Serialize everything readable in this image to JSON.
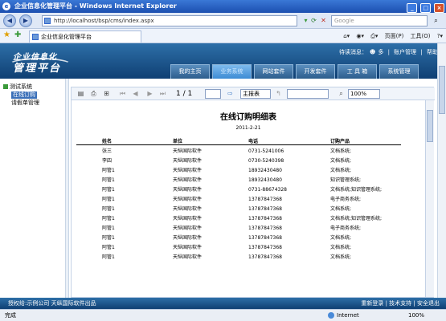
{
  "window": {
    "title": "企业信息化管理平台 - Windows Internet Explorer",
    "minimize": "_",
    "maximize": "□",
    "close": "×"
  },
  "address": {
    "url": "http://localhost/bsp/cms/index.aspx",
    "search_placeholder": "Google"
  },
  "tab": {
    "title": "企业信息化管理平台"
  },
  "toolbar_right": {
    "page": "页面(P)",
    "tools": "工具(O)"
  },
  "site": {
    "logo_line1": "企业信息化",
    "logo_line2": "管理平台",
    "message_prefix": "待读消息：",
    "message_user": "多",
    "account": "账户管理",
    "help": "帮助",
    "separator": "|"
  },
  "nav_tabs": [
    {
      "label": "我的主页"
    },
    {
      "label": "业务系统"
    },
    {
      "label": "网站套件"
    },
    {
      "label": "开发套件"
    },
    {
      "label": "工 具 箱"
    },
    {
      "label": "系统管理"
    }
  ],
  "sidebar": {
    "root": "测试系统",
    "items": [
      {
        "label": "在线订购"
      },
      {
        "label": "请假单管理"
      }
    ]
  },
  "report_toolbar": {
    "page_indicator": "1 / 1",
    "format": "主报表",
    "zoom": "100%"
  },
  "report": {
    "title": "在线订购明细表",
    "date": "2011-2-21",
    "columns": [
      "姓名",
      "单位",
      "电话",
      "订购产品"
    ],
    "rows": [
      [
        "张三",
        "天纵国际软件",
        "0731-5241006",
        "文档系统;"
      ],
      [
        "李四",
        "天纵国际软件",
        "0730-5240398",
        "文档系统;"
      ],
      [
        "阿管1",
        "天纵国际软件",
        "18932430480",
        "文档系统;"
      ],
      [
        "阿管1",
        "天纵国际软件",
        "18932430480",
        "知识管理系统;"
      ],
      [
        "阿管1",
        "天纵国际软件",
        "0731-88674328",
        "文档系统;知识管理系统;"
      ],
      [
        "阿管1",
        "天纵国际软件",
        "13787847368",
        "电子商务系统;"
      ],
      [
        "阿管1",
        "天纵国际软件",
        "13787847368",
        "文档系统;"
      ],
      [
        "阿管1",
        "天纵国际软件",
        "13787847368",
        "文档系统;知识管理系统;"
      ],
      [
        "阿管1",
        "天纵国际软件",
        "13787847368",
        "电子商务系统;"
      ],
      [
        "阿管1",
        "天纵国际软件",
        "13787847368",
        "文档系统;"
      ],
      [
        "阿管1",
        "天纵国际软件",
        "13787847368",
        "文档系统;"
      ],
      [
        "阿管1",
        "天纵国际软件",
        "13787847368",
        "文档系统;"
      ]
    ]
  },
  "footer": {
    "left": "授权给:示例公司 天纵国际软件出品",
    "right": "重新登录 | 技术支持 | 安全退出"
  },
  "statusbar": {
    "status": "完成",
    "zone": "Internet",
    "zoom": "100%"
  },
  "colors": {
    "accent": "#2d6fa8",
    "active_tab": "#3c8bd4"
  }
}
